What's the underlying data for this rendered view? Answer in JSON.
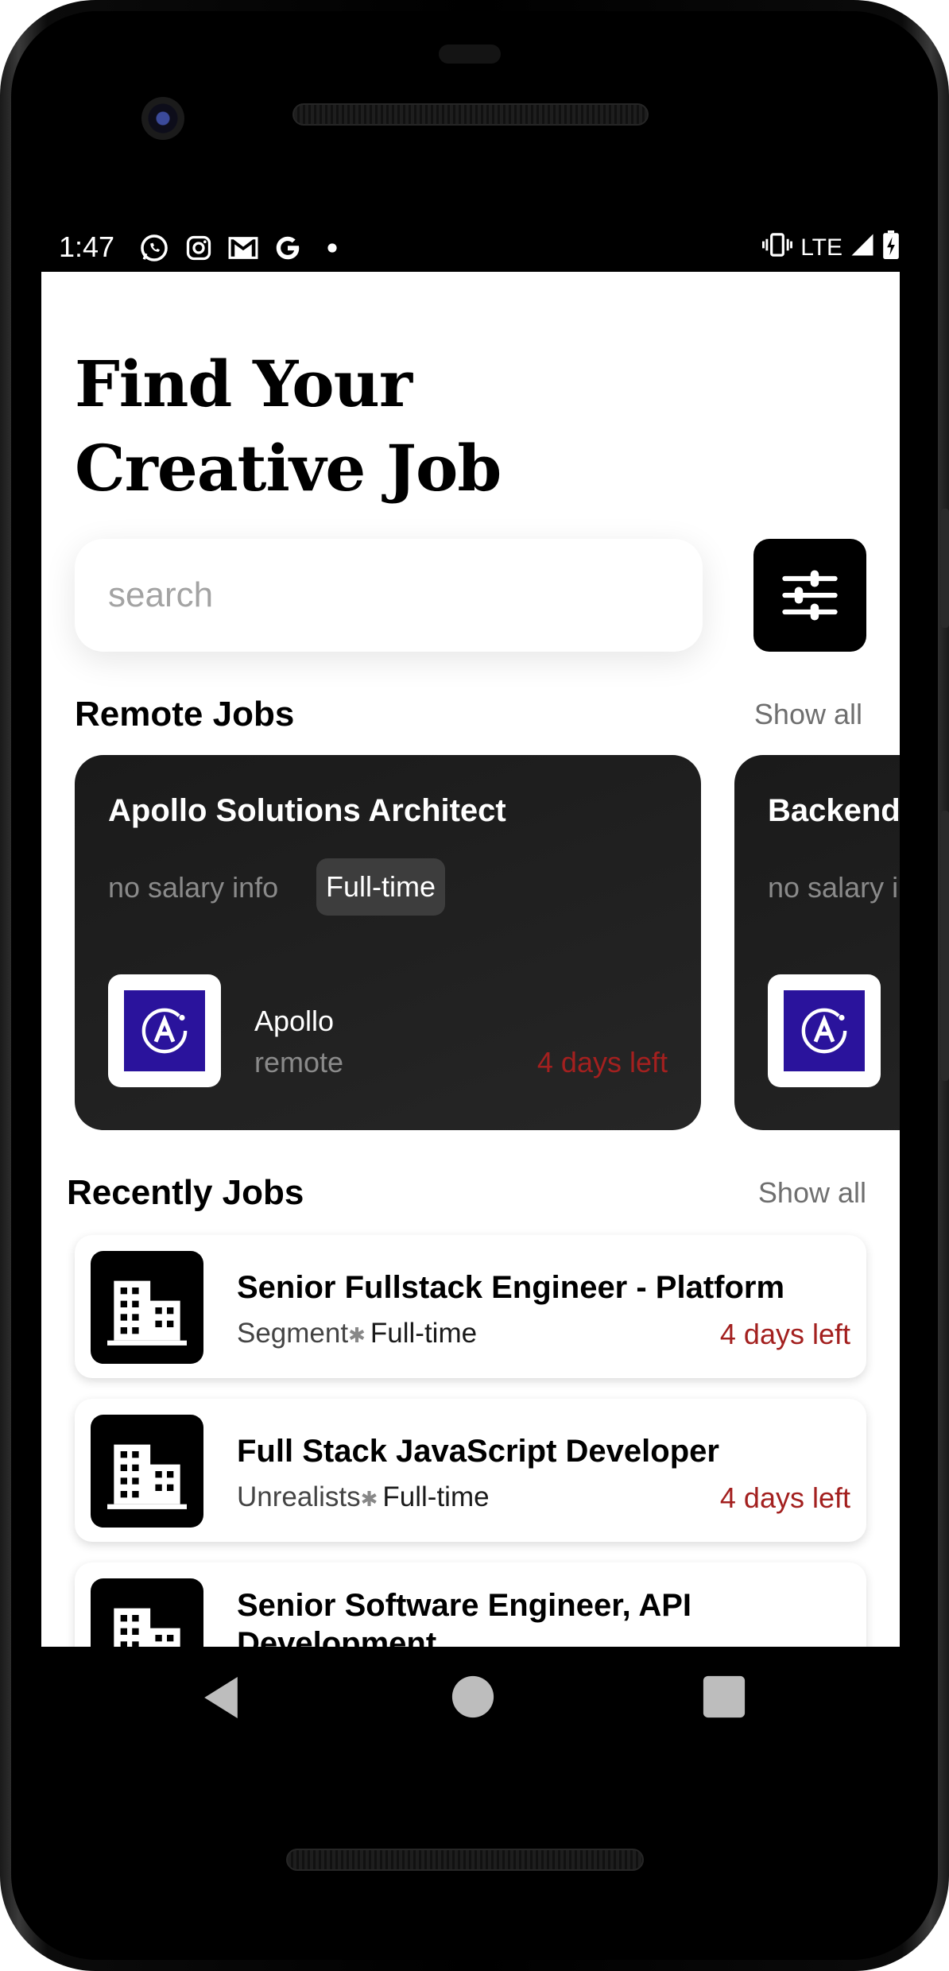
{
  "status_bar": {
    "time": "1:47",
    "left_icons": [
      "whatsapp-icon",
      "instagram-icon",
      "gmail-icon",
      "google-icon",
      "dot-icon"
    ],
    "network": "LTE",
    "right_icons": [
      "vibrate-icon",
      "signal-icon",
      "battery-charging-icon"
    ]
  },
  "page": {
    "title_line1": "Find Your",
    "title_line2": "Creative Job"
  },
  "search": {
    "placeholder": "search",
    "value": ""
  },
  "filter_button": {
    "icon": "sliders-icon"
  },
  "remote_jobs": {
    "section_title": "Remote Jobs",
    "show_all_label": "Show all",
    "cards": [
      {
        "title": "Apollo Solutions Architect",
        "salary": "no salary info",
        "type": "Full-time",
        "company": "Apollo",
        "location": "remote",
        "days_left": "4 days left"
      },
      {
        "title": "Backend",
        "salary": "no salary i"
      }
    ]
  },
  "recent_jobs": {
    "section_title": "Recently Jobs",
    "show_all_label": "Show all",
    "items": [
      {
        "title": "Senior Fullstack Engineer - Platform",
        "company": "Segment",
        "type": "Full-time",
        "days_left": "4 days left"
      },
      {
        "title": "Full Stack JavaScript Developer",
        "company": "Unrealists",
        "type": "Full-time",
        "days_left": "4 days left"
      },
      {
        "title": "Senior Software Engineer, API Development",
        "company": "",
        "type": "",
        "days_left": ""
      }
    ]
  },
  "nav_bar": {
    "buttons": [
      "back-icon",
      "home-icon",
      "recents-icon"
    ]
  },
  "colors": {
    "accent_days": "#a3201f",
    "card_dark": "#1e1e1e",
    "apollo_logo": "#2a139c"
  }
}
